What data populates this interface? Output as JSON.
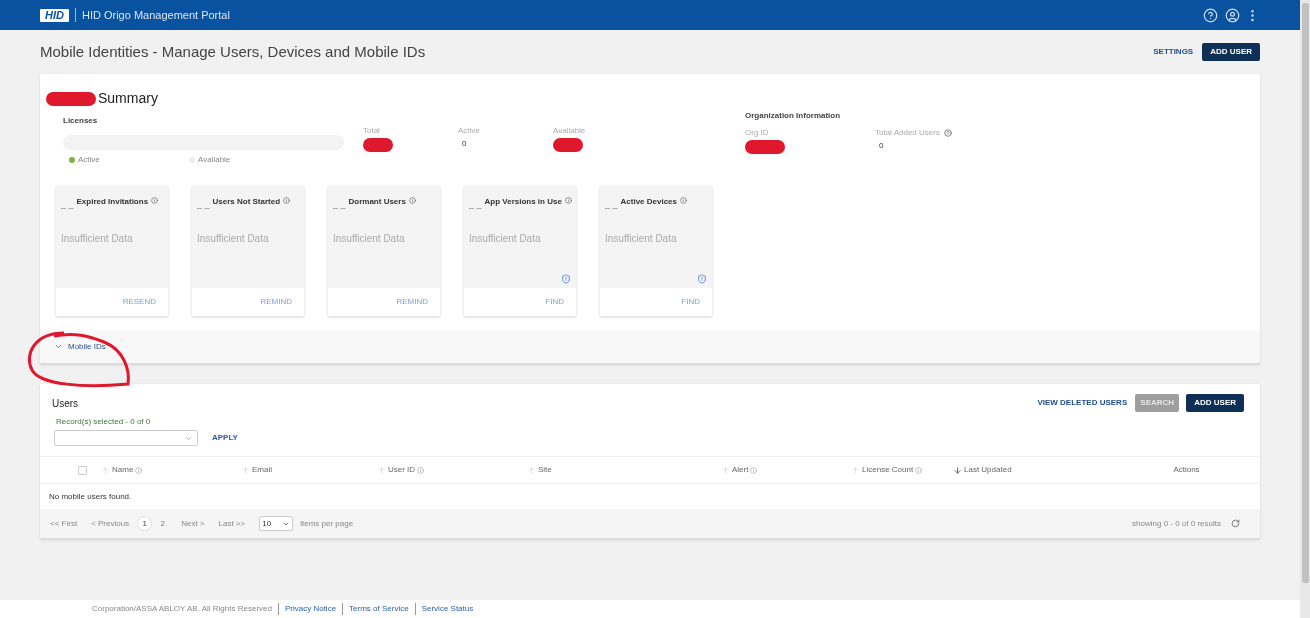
{
  "header": {
    "logo": "HID",
    "title": "HID Origo Management Portal"
  },
  "page": {
    "title": "Mobile Identities - Manage Users, Devices and Mobile IDs",
    "settings": "SETTINGS",
    "add_user": "ADD USER"
  },
  "summary": {
    "title": "Summary",
    "title_redacted": true,
    "licenses": {
      "title": "Licenses",
      "legend": [
        {
          "label": "Active",
          "color": "#7cb342"
        },
        {
          "label": "Available",
          "color": "#eeeeee"
        }
      ],
      "stats": [
        {
          "label": "Total",
          "redacted": true
        },
        {
          "label": "Active",
          "value": "0",
          "redacted": false
        },
        {
          "label": "Available",
          "redacted": true
        }
      ]
    },
    "org": {
      "title": "Organization Information",
      "fields": [
        {
          "label": "Org ID",
          "redacted": true,
          "info": false
        },
        {
          "label": "Total Added Users",
          "value": "0",
          "redacted": false,
          "info": true
        }
      ]
    },
    "cards": [
      {
        "value": "_ _",
        "title": "Expired Invitations",
        "body": "Insufficient Data",
        "shield": false,
        "action": "RESEND"
      },
      {
        "value": "_ _",
        "title": "Users Not Started",
        "body": "Insufficient Data",
        "shield": false,
        "action": "REMIND"
      },
      {
        "value": "_ _",
        "title": "Dormant Users",
        "body": "Insufficient Data",
        "shield": false,
        "action": "REMIND"
      },
      {
        "value": "_ _",
        "title": "App Versions in Use",
        "body": "Insufficient Data",
        "shield": true,
        "action": "FIND"
      },
      {
        "value": "_ _",
        "title": "Active Devices",
        "body": "Insufficient Data",
        "shield": true,
        "action": "FIND"
      }
    ],
    "mobile_ids": {
      "label": "Mobile IDs",
      "expanded": false
    }
  },
  "users": {
    "title": "Users",
    "view_deleted": "VIEW DELETED USERS",
    "search": {
      "label": "SEARCH",
      "disabled": true
    },
    "add_user": "ADD USER",
    "records": "Record(s) selected - 0 of  0",
    "apply": "APPLY",
    "select_all": {
      "checked": false
    },
    "columns": [
      {
        "label": "Name",
        "sortable": true,
        "descending": false,
        "info": true
      },
      {
        "label": "Email",
        "sortable": true,
        "descending": false,
        "info": false
      },
      {
        "label": "User ID",
        "sortable": true,
        "descending": false,
        "info": true
      },
      {
        "label": "Site",
        "sortable": true,
        "descending": false,
        "info": false
      },
      {
        "label": "Alert",
        "sortable": true,
        "descending": false,
        "info": true
      },
      {
        "label": "License Count",
        "sortable": true,
        "descending": false,
        "info": true
      },
      {
        "label": "Last Updated",
        "sortable": true,
        "descending": true,
        "info": false
      },
      {
        "label": "Actions",
        "sortable": false,
        "info": false
      }
    ],
    "empty": "No mobile users found.",
    "pagination": {
      "first": "<< First",
      "previous": "< Previous",
      "pages": [
        {
          "label": "1",
          "selected": true
        },
        {
          "label": "2",
          "selected": false
        }
      ],
      "next": "Next >",
      "last": "Last >>",
      "per_page": "10",
      "per_page_label": "items per page",
      "showing": "showing 0 - 0 of 0 results"
    }
  },
  "footer": {
    "copyright": "Corporation/ASSA ABLOY AB. All Rights Reserved",
    "links": [
      "Privacy Notice",
      "Terms of Service",
      "Service Status"
    ]
  }
}
